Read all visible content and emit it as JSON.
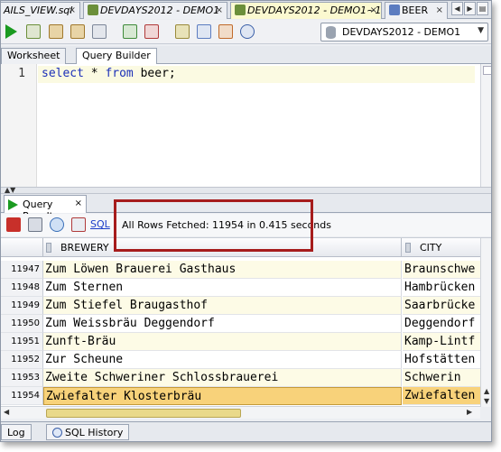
{
  "file_tabs": [
    {
      "label": "AILS_VIEW.sql",
      "close": "×"
    },
    {
      "label": "DEVDAYS2012 - DEMO1",
      "close": "×"
    },
    {
      "label": "DEVDAYS2012 - DEMO1~1",
      "close": "×"
    },
    {
      "label": "BEER",
      "close": "×"
    }
  ],
  "connection": {
    "label": "DEVDAYS2012 - DEMO1"
  },
  "worksheet_tabs": {
    "worksheet": "Worksheet",
    "query_builder": "Query Builder"
  },
  "editor": {
    "line_number": "1",
    "kw_select": "select",
    "star": " * ",
    "kw_from": "from",
    "rest": " beer;"
  },
  "result_tab": {
    "label": "Query Result",
    "close": "×"
  },
  "result_toolbar": {
    "sql_link": "SQL",
    "status": "All Rows Fetched: 11954 in 0.415 seconds"
  },
  "grid": {
    "columns": [
      "BREWERY",
      "CITY"
    ],
    "rows": [
      {
        "num": "11947",
        "brewery": "Zum Löwen Brauerei Gasthaus",
        "city": "Braunschwe"
      },
      {
        "num": "11948",
        "brewery": "Zum Sternen",
        "city": "Hambrücken"
      },
      {
        "num": "11949",
        "brewery": "Zum Stiefel Braugasthof",
        "city": "Saarbrücke"
      },
      {
        "num": "11950",
        "brewery": "Zum Weissbräu Deggendorf",
        "city": "Deggendorf"
      },
      {
        "num": "11951",
        "brewery": "Zunft-Bräu",
        "city": "Kamp-Lintf"
      },
      {
        "num": "11952",
        "brewery": "Zur Scheune",
        "city": "Hofstätten"
      },
      {
        "num": "11953",
        "brewery": "Zweite Schweriner Schlossbrauerei",
        "city": "Schwerin"
      },
      {
        "num": "11954",
        "brewery": "Zwiefalter Klosterbräu",
        "city": "Zwiefalten"
      }
    ]
  },
  "bottom_tabs": {
    "log": "Log",
    "sql_history": "SQL History"
  }
}
